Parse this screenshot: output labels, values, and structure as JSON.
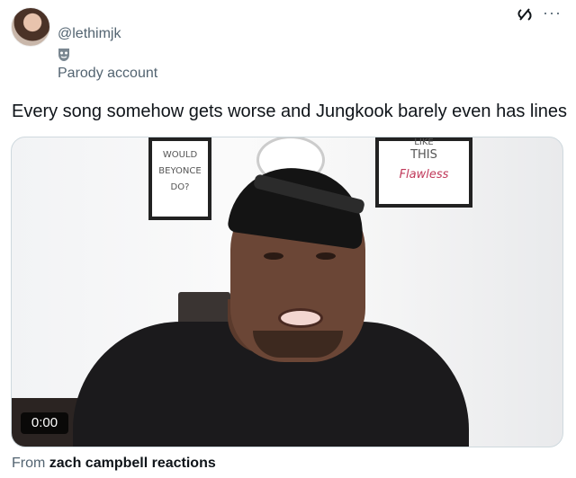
{
  "author": {
    "handle": "@lethimjk",
    "badge_label": "Parody account"
  },
  "tweet": {
    "text": "Every song somehow gets worse and Jungkook barely even has lines"
  },
  "media": {
    "timestamp": "0:00",
    "poster_left_text": [
      "WOULD",
      "BEYONCE",
      "DO?"
    ],
    "poster_right_text": [
      "LIKE",
      "THIS",
      "Flawless"
    ]
  },
  "attribution": {
    "prefix": "From",
    "source": "zach campbell reactions"
  },
  "icons": {
    "grok": "grok-icon",
    "more": "more-icon",
    "parody": "theater-mask-icon"
  }
}
